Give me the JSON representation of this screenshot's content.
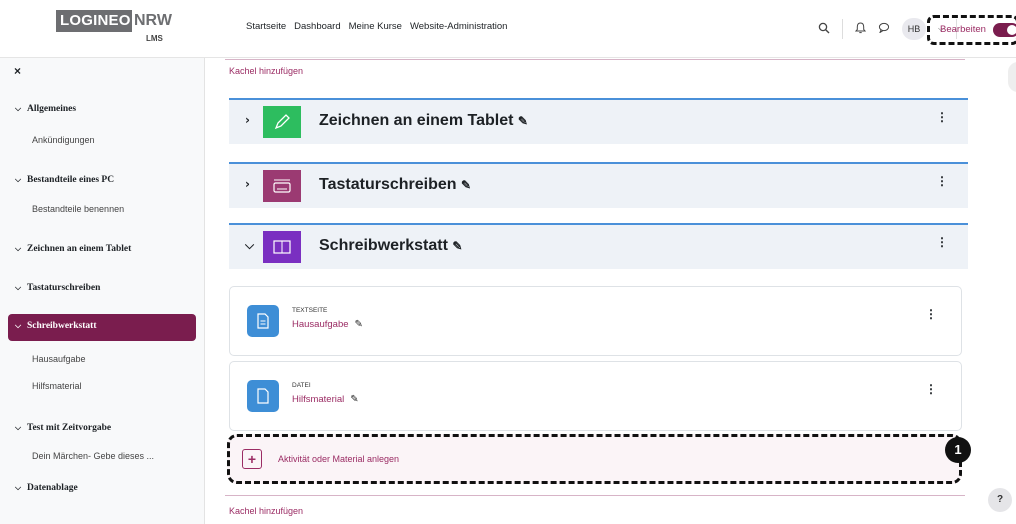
{
  "header": {
    "logo_main": "LOGINEO",
    "logo_nrw": "NRW",
    "logo_sub": "LMS",
    "nav": [
      "Startseite",
      "Dashboard",
      "Meine Kurse",
      "Website-Administration"
    ],
    "avatar": "HB",
    "edit_label": "Bearbeiten"
  },
  "sidebar": {
    "close": "×",
    "sections": [
      {
        "label": "Allgemeines",
        "items": [
          "Ankündigungen"
        ]
      },
      {
        "label": "Bestandteile eines PC",
        "items": [
          "Bestandteile benennen"
        ]
      },
      {
        "label": "Zeichnen an einem Tablet",
        "items": []
      },
      {
        "label": "Tastaturschreiben",
        "items": []
      },
      {
        "label": "Schreibwerkstatt",
        "items": [
          "Hausaufgabe",
          "Hilfsmaterial"
        ]
      },
      {
        "label": "Test mit Zeitvorgabe",
        "items": [
          "Dein Märchen- Gebe dieses ..."
        ]
      },
      {
        "label": "Datenablage",
        "items": []
      }
    ]
  },
  "main": {
    "add_tile": "Kachel hinzufügen",
    "sections": [
      {
        "title": "Zeichnen an einem Tablet",
        "color": "#2dbd5f"
      },
      {
        "title": "Tastaturschreiben",
        "color": "#9b3a72"
      },
      {
        "title": "Schreibwerkstatt",
        "color": "#7a2fc1"
      }
    ],
    "activities": [
      {
        "type": "TEXTSEITE",
        "name": "Hausaufgabe"
      },
      {
        "type": "DATEI",
        "name": "Hilfsmaterial"
      }
    ],
    "add_activity": "Aktivität oder Material anlegen",
    "callout": "1",
    "add_tile_bottom": "Kachel hinzufügen"
  },
  "help": "?"
}
